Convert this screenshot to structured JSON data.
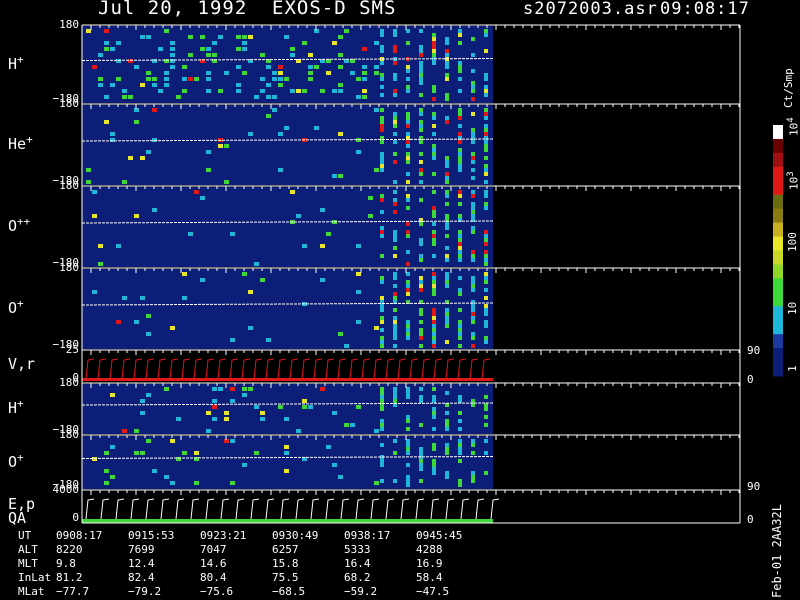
{
  "header": {
    "date": "Jul 20, 1992",
    "instrument": "EXOS-D SMS",
    "file": "s2072003.asr",
    "time": "09:08:17"
  },
  "colorbar": {
    "label": "Ct/Smp",
    "ticks": [
      "1",
      "10",
      "100",
      "10",
      "10"
    ],
    "exponents": [
      "",
      "",
      "",
      "3",
      "4"
    ]
  },
  "footer": {
    "note": "Feb-01 2AA32L"
  },
  "chart_data": {
    "type": "heatmap",
    "panels": [
      {
        "label": "H",
        "sup": "+",
        "ymax": "180",
        "ymin": "−180"
      },
      {
        "label": "He",
        "sup": "+",
        "ymax": "180",
        "ymin": "−180"
      },
      {
        "label": "O",
        "sup": "++",
        "ymax": "180",
        "ymin": "−180"
      },
      {
        "label": "O",
        "sup": "+",
        "ymax": "180",
        "ymin": "−180"
      },
      {
        "label": "V,r",
        "sup": "",
        "ymax": "25",
        "ymin": "0",
        "right_top": "90",
        "right_bottom": "0"
      },
      {
        "label": "H",
        "sup": "+",
        "ymax": "180",
        "ymin": "−180"
      },
      {
        "label": "O",
        "sup": "+",
        "ymax": "180",
        "ymin": "−180",
        "right_bottom": "90"
      },
      {
        "label": "E,p",
        "label2": "QA",
        "sup": "",
        "ymax": "4000",
        "ymin": "0",
        "right_bottom": "0"
      }
    ],
    "ephemeris": {
      "labels": [
        "UT",
        "ALT",
        "MLT",
        "InLat",
        "MLat"
      ],
      "rows": [
        [
          "0908:17",
          "0915:53",
          "0923:21",
          "0930:49",
          "0938:17",
          "0945:45"
        ],
        [
          "8220",
          "7699",
          "7047",
          "6257",
          "5333",
          "4288"
        ],
        [
          "9.8",
          "12.4",
          "14.6",
          "15.8",
          "16.4",
          "16.9"
        ],
        [
          "81.2",
          "82.4",
          "80.4",
          "75.5",
          "68.2",
          "58.4"
        ],
        [
          "−77.7",
          "−79.2",
          "−75.6",
          "−68.5",
          "−59.2",
          "−47.5"
        ]
      ]
    },
    "colors": {
      "background": "#0d1e78",
      "low": "#0d1e78",
      "cyan": "#1fb6d8",
      "green": "#3fd83a",
      "yellow": "#e8e62a",
      "red": "#e01818",
      "axis": "#ffffff"
    }
  }
}
